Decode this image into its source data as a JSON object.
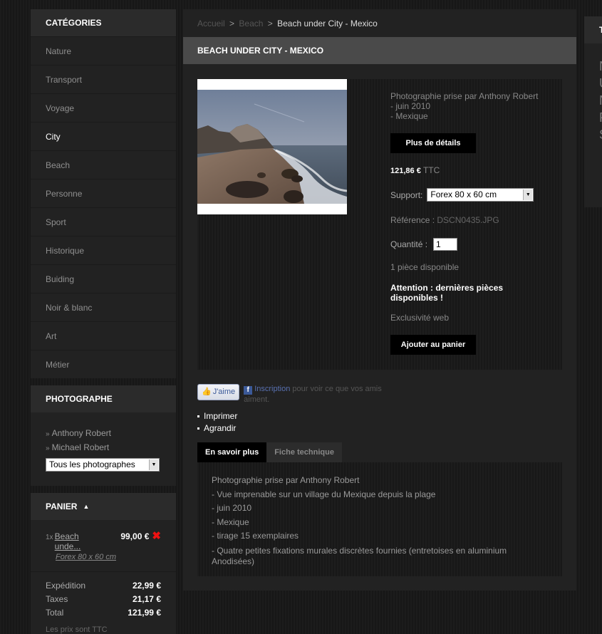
{
  "categories": {
    "title": "CATÉGORIES",
    "items": [
      "Nature",
      "Transport",
      "Voyage",
      "City",
      "Beach",
      "Personne",
      "Sport",
      "Historique",
      "Buiding",
      "Noir & blanc",
      "Art",
      "Métier"
    ],
    "active": "City"
  },
  "photographers": {
    "title": "PHOTOGRAPHE",
    "items": [
      "Anthony Robert",
      "Michael Robert"
    ],
    "select_value": "Tous les photographes"
  },
  "cart": {
    "title": "PANIER",
    "line": {
      "qty": "1x",
      "name": "Beach unde...",
      "price": "99,00 €",
      "variant": "Forex 80 x 60 cm"
    },
    "shipping_label": "Expédition",
    "shipping": "22,99 €",
    "tax_label": "Taxes",
    "tax": "21,17 €",
    "total_label": "Total",
    "total": "121,99 €",
    "note": "Les prix sont TTC"
  },
  "breadcrumb": {
    "home": "Accueil",
    "category": "Beach",
    "sep": ">",
    "current": "Beach under City - Mexico"
  },
  "product": {
    "title": "BEACH UNDER CITY - MEXICO",
    "credit_1": "Photographie prise par Anthony Robert",
    "credit_2": "- juin 2010",
    "credit_3": "- Mexique",
    "details_button": "Plus de détails",
    "price": "121,86 €",
    "price_suffix": "TTC",
    "support_label": "Support:",
    "support_value": "Forex 80 x 60 cm",
    "ref_label": "Référence :",
    "ref_value": "DSCN0435.JPG",
    "qty_label": "Quantité :",
    "qty_value": "1",
    "availability": "1 pièce disponible",
    "warning": "Attention : dernières pièces disponibles !",
    "exclusive": "Exclusivité web",
    "add_button": "Ajouter au panier"
  },
  "social": {
    "like_label": "J'aime",
    "signup": "Inscription",
    "signup_text": " pour voir ce que vos amis aiment."
  },
  "actions": [
    "Imprimer",
    "Agrandir"
  ],
  "tabs": [
    "En savoir plus",
    "Fiche technique"
  ],
  "description": [
    "Photographie prise par Anthony Robert",
    "- Vue imprenable sur un village du Mexique depuis la plage",
    "- juin 2010",
    "- Mexique",
    "- tirage 15 exemplaires",
    "- Quatre petites fixations murales discrètes fournies (entretoises en aluminium Anodisées)"
  ],
  "right_panel": {
    "title_char": "T",
    "chars": [
      "N",
      "U",
      "N",
      "P",
      "S"
    ]
  },
  "colors": {
    "background": "#1a1a1a",
    "panel": "#222222",
    "title_bar": "#4a4a4a",
    "delete": "#e11111",
    "facebook": "#3b5998"
  }
}
